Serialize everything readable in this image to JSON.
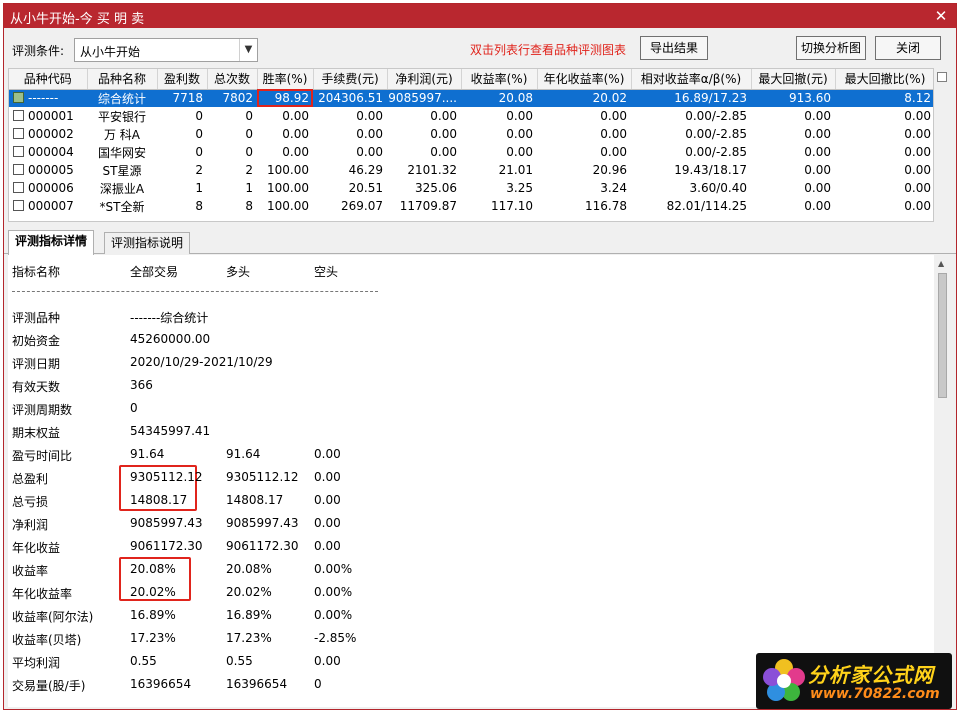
{
  "window": {
    "title": "从小牛开始-今 买 明 卖",
    "close_glyph": "✕"
  },
  "toolbar": {
    "condition_label": "评测条件:",
    "condition_value": "从小牛开始",
    "hint": "双击列表行查看品种评测图表",
    "export_label": "导出结果",
    "switch_label": "切换分析图",
    "close_label": "关闭"
  },
  "grid": {
    "columns": [
      "品种代码",
      "品种名称",
      "盈利数",
      "总次数",
      "胜率(%)",
      "手续费(元)",
      "净利润(元)",
      "收益率(%)",
      "年化收益率(%)",
      "相对收益率α/β(%)",
      "最大回撤(元)",
      "最大回撤比(%)"
    ],
    "rows": [
      [
        "-------",
        "综合统计",
        "7718",
        "7802",
        "98.92",
        "204306.51",
        "9085997....",
        "20.08",
        "20.02",
        "16.89/17.23",
        "913.60",
        "8.12"
      ],
      [
        "000001",
        "平安银行",
        "0",
        "0",
        "0.00",
        "0.00",
        "0.00",
        "0.00",
        "0.00",
        "0.00/-2.85",
        "0.00",
        "0.00"
      ],
      [
        "000002",
        "万 科A",
        "0",
        "0",
        "0.00",
        "0.00",
        "0.00",
        "0.00",
        "0.00",
        "0.00/-2.85",
        "0.00",
        "0.00"
      ],
      [
        "000004",
        "国华网安",
        "0",
        "0",
        "0.00",
        "0.00",
        "0.00",
        "0.00",
        "0.00",
        "0.00/-2.85",
        "0.00",
        "0.00"
      ],
      [
        "000005",
        "ST星源",
        "2",
        "2",
        "100.00",
        "46.29",
        "2101.32",
        "21.01",
        "20.96",
        "19.43/18.17",
        "0.00",
        "0.00"
      ],
      [
        "000006",
        "深振业A",
        "1",
        "1",
        "100.00",
        "20.51",
        "325.06",
        "3.25",
        "3.24",
        "3.60/0.40",
        "0.00",
        "0.00"
      ],
      [
        "000007",
        "*ST全新",
        "8",
        "8",
        "100.00",
        "269.07",
        "11709.87",
        "117.10",
        "116.78",
        "82.01/114.25",
        "0.00",
        "0.00"
      ]
    ]
  },
  "tabs": [
    "评测指标详情",
    "评测指标说明"
  ],
  "detail": {
    "headers": [
      "指标名称",
      "全部交易",
      "多头",
      "空头"
    ],
    "rows": [
      [
        "评测品种",
        "-------综合统计",
        "",
        ""
      ],
      [
        "初始资金",
        "45260000.00",
        "",
        ""
      ],
      [
        "评测日期",
        "2020/10/29-2021/10/29",
        "",
        ""
      ],
      [
        "有效天数",
        "366",
        "",
        ""
      ],
      [
        "评测周期数",
        "0",
        "",
        ""
      ],
      [
        "期末权益",
        "54345997.41",
        "",
        ""
      ],
      [
        "盈亏时间比",
        "91.64",
        "91.64",
        "0.00"
      ],
      [
        "总盈利",
        "9305112.12",
        "9305112.12",
        "0.00"
      ],
      [
        "总亏损",
        "14808.17",
        "14808.17",
        "0.00"
      ],
      [
        "净利润",
        "9085997.43",
        "9085997.43",
        "0.00"
      ],
      [
        "年化收益",
        "9061172.30",
        "9061172.30",
        "0.00"
      ],
      [
        "收益率",
        "20.08%",
        "20.08%",
        "0.00%"
      ],
      [
        "年化收益率",
        "20.02%",
        "20.02%",
        "0.00%"
      ],
      [
        "收益率(阿尔法)",
        "16.89%",
        "16.89%",
        "0.00%"
      ],
      [
        "收益率(贝塔)",
        "17.23%",
        "17.23%",
        "-2.85%"
      ],
      [
        "平均利润",
        "0.55",
        "0.55",
        "0.00"
      ],
      [
        "交易量(股/手)",
        "16396654",
        "16396654",
        "0"
      ]
    ]
  },
  "logo": {
    "brand": "分析家公式网",
    "site": "www.70822.com"
  },
  "colors": {
    "title_bar": "#b9272f",
    "selection": "#0f6fd0",
    "highlight": "#e0241c",
    "hint": "#e0241c"
  }
}
